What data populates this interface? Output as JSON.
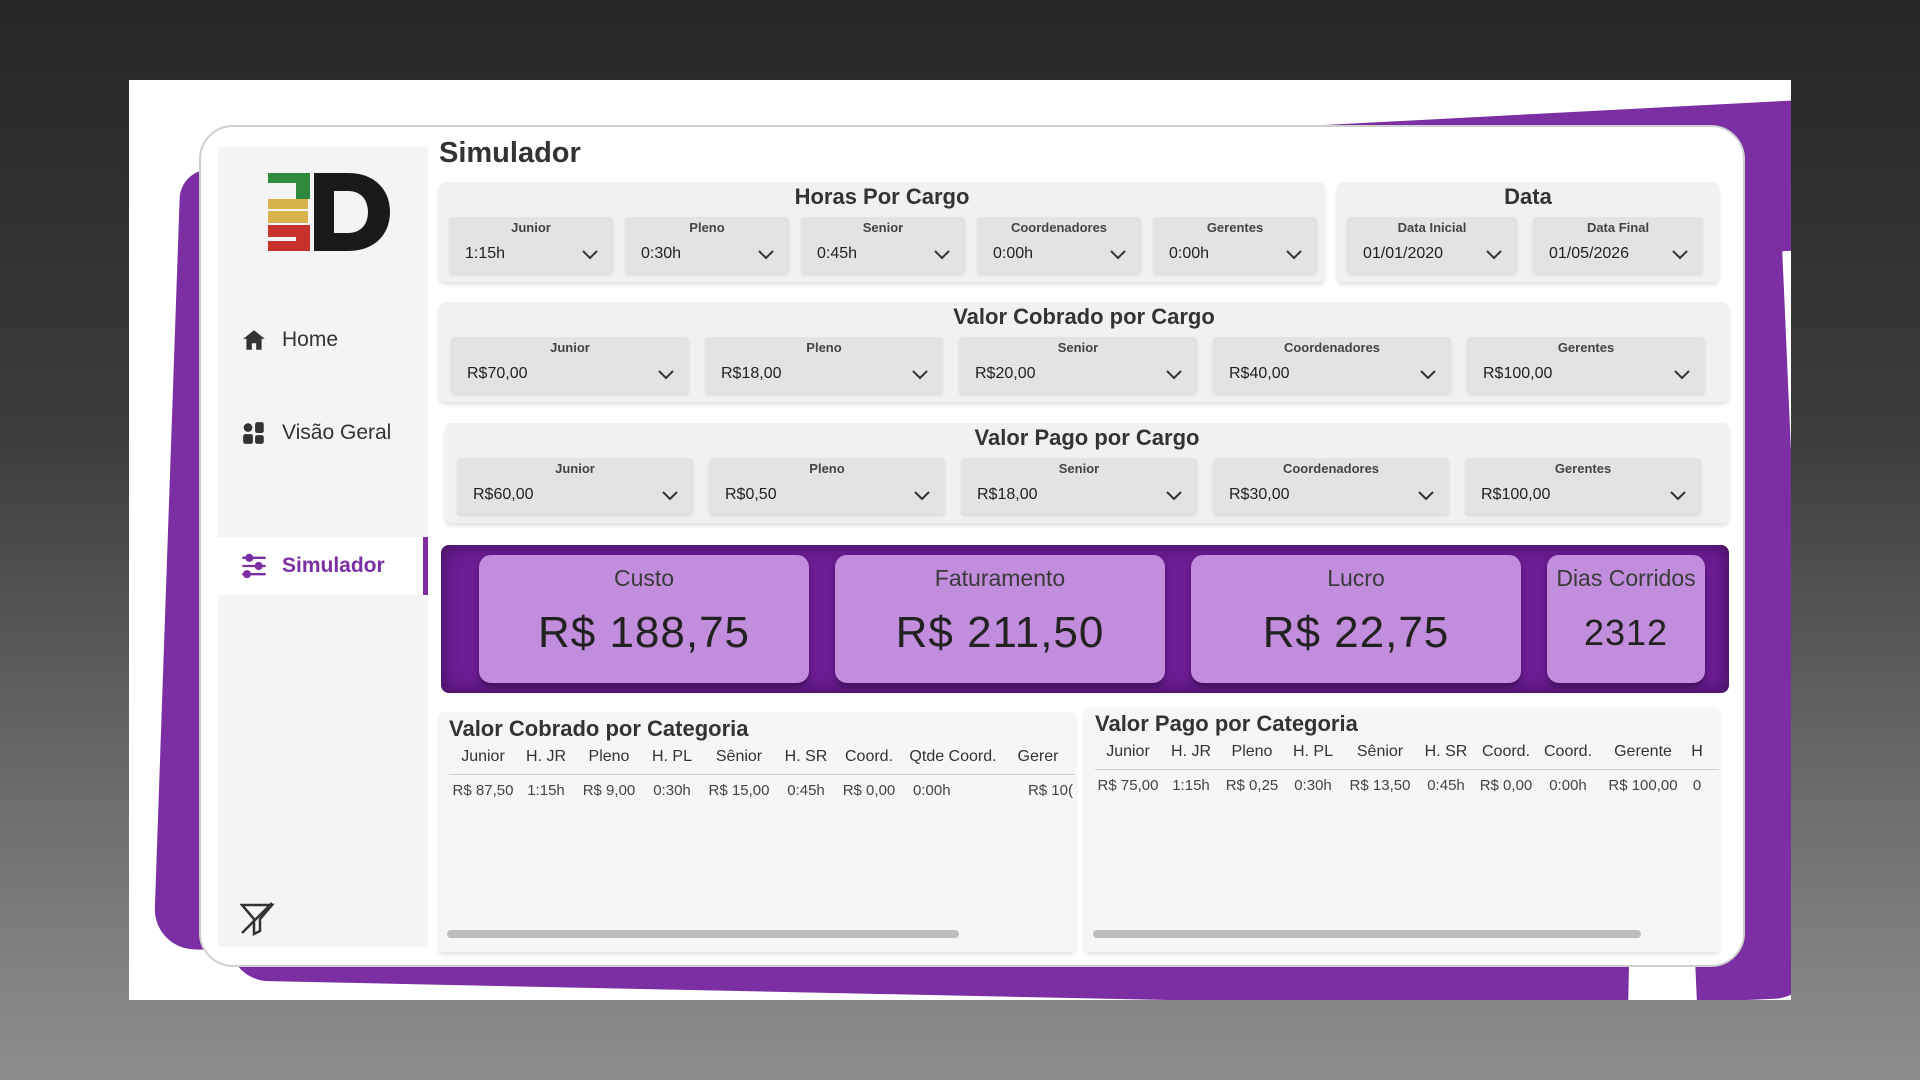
{
  "sidebar": {
    "items": [
      {
        "label": "Home",
        "icon": "home-icon"
      },
      {
        "label": "Visão Geral",
        "icon": "dashboard-icon"
      },
      {
        "label": "Simulador",
        "icon": "sliders-icon",
        "active": true
      }
    ]
  },
  "page": {
    "title": "Simulador"
  },
  "horas": {
    "title": "Horas Por Cargo",
    "slicers": [
      {
        "label": "Junior",
        "value": "1:15h"
      },
      {
        "label": "Pleno",
        "value": "0:30h"
      },
      {
        "label": "Senior",
        "value": "0:45h"
      },
      {
        "label": "Coordenadores",
        "value": "0:00h"
      },
      {
        "label": "Gerentes",
        "value": "0:00h"
      }
    ]
  },
  "data": {
    "title": "Data",
    "slicers": [
      {
        "label": "Data Inicial",
        "value": "01/01/2020"
      },
      {
        "label": "Data Final",
        "value": "01/05/2026"
      }
    ]
  },
  "cobrado": {
    "title": "Valor Cobrado por Cargo",
    "slicers": [
      {
        "label": "Junior",
        "value": "R$70,00"
      },
      {
        "label": "Pleno",
        "value": "R$18,00"
      },
      {
        "label": "Senior",
        "value": "R$20,00"
      },
      {
        "label": "Coordenadores",
        "value": "R$40,00"
      },
      {
        "label": "Gerentes",
        "value": "R$100,00"
      }
    ]
  },
  "pago": {
    "title": "Valor Pago por Cargo",
    "slicers": [
      {
        "label": "Junior",
        "value": "R$60,00"
      },
      {
        "label": "Pleno",
        "value": "R$0,50"
      },
      {
        "label": "Senior",
        "value": "R$18,00"
      },
      {
        "label": "Coordenadores",
        "value": "R$30,00"
      },
      {
        "label": "Gerentes",
        "value": "R$100,00"
      }
    ]
  },
  "kpis": [
    {
      "label": "Custo",
      "value": "R$ 188,75"
    },
    {
      "label": "Faturamento",
      "value": "R$ 211,50"
    },
    {
      "label": "Lucro",
      "value": "R$ 22,75"
    },
    {
      "label": "Dias Corridos",
      "value": "2312"
    }
  ],
  "table_cobrado": {
    "title": "Valor Cobrado por Categoria",
    "headers": [
      "Junior",
      "H. JR",
      "Pleno",
      "H. PL",
      "Sênior",
      "H. SR",
      "Coord.",
      "Qtde Coord.",
      "Gerer"
    ],
    "row": [
      "R$ 87,50",
      "1:15h",
      "R$ 9,00",
      "0:30h",
      "R$ 15,00",
      "0:45h",
      "R$ 0,00",
      "0:00h",
      "R$ 10("
    ]
  },
  "table_pago": {
    "title": "Valor Pago por Categoria",
    "headers": [
      "Junior",
      "H. JR",
      "Pleno",
      "H. PL",
      "Sênior",
      "H. SR",
      "Coord.",
      "Coord.",
      "Gerente",
      "H"
    ],
    "row": [
      "R$ 75,00",
      "1:15h",
      "R$ 0,25",
      "0:30h",
      "R$ 13,50",
      "0:45h",
      "R$ 0,00",
      "0:00h",
      "R$ 100,00",
      "0"
    ]
  },
  "colors": {
    "accent": "#7b2fa3",
    "kpi_band": "#6c1c94",
    "kpi_card": "#c18ddc",
    "logo_green": "#2e8b3e",
    "logo_yellow": "#d8b24a",
    "logo_red": "#c8302c"
  }
}
